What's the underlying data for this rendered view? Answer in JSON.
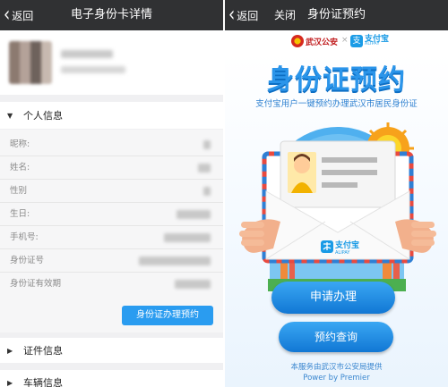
{
  "left": {
    "nav": {
      "back_label": "返回",
      "title": "电子身份卡详情"
    },
    "personal_info": {
      "heading": "个人信息",
      "fields": [
        {
          "label": "昵称:"
        },
        {
          "label": "姓名:"
        },
        {
          "label": "性别"
        },
        {
          "label": "生日:"
        },
        {
          "label": "手机号:"
        },
        {
          "label": "身份证号"
        },
        {
          "label": "身份证有效期"
        }
      ],
      "appointment_button": "身份证办理预约"
    },
    "documents_section": "证件信息",
    "vehicle_section": "车辆信息"
  },
  "right": {
    "nav": {
      "back_label": "返回",
      "close_label": "关闭",
      "title": "身份证预约"
    },
    "logos": {
      "police": "武汉公安",
      "separator": "×",
      "alipay": "支付宝",
      "alipay_en": "ALIPAY",
      "card_brand": "支付宝",
      "card_brand_en": "ALIPAY"
    },
    "hero_title": "身份证预约",
    "hero_subtitle": "支付宝用户一键预约办理武汉市居民身份证",
    "apply_button": "申请办理",
    "query_button": "预约查询",
    "footer_line1": "本服务由武汉市公安局提供",
    "footer_line2": "Power by Premier"
  },
  "colors": {
    "navbar": "#303133",
    "accent_blue": "#2a9cf0",
    "brand_blue": "#1a9be6",
    "police_red": "#c0191b"
  }
}
